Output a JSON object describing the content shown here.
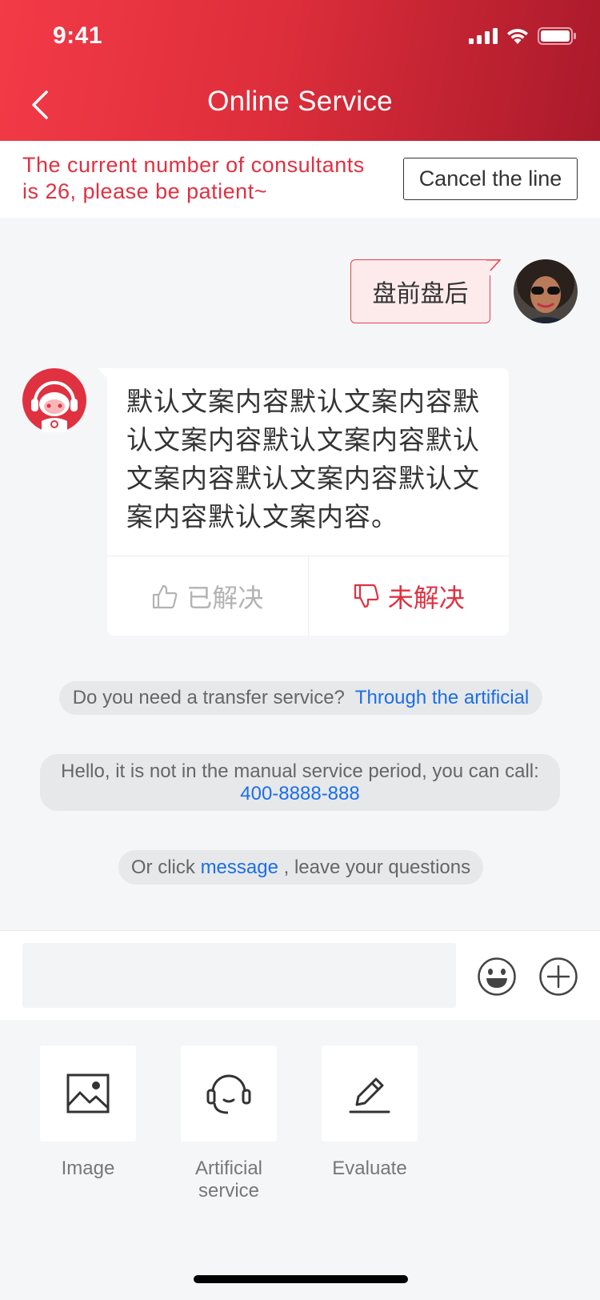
{
  "status_bar": {
    "time": "9:41"
  },
  "header": {
    "title": "Online Service"
  },
  "queue": {
    "notice": "The current number of consultants is 26, please be patient~",
    "cancel_label": "Cancel the line"
  },
  "messages": {
    "user_text": "盘前盘后",
    "bot_text": "默认文案内容默认文案内容默认文案内容默认文案内容默认文案内容默认文案内容默认文案内容默认文案内容。",
    "resolved_label": "已解决",
    "unresolved_label": "未解决"
  },
  "system": {
    "transfer_question": "Do you need a transfer service?",
    "transfer_link": "Through the artificial",
    "offhours_text": "Hello, it is not in the manual service period, you can call:",
    "phone": "400-8888-888",
    "leave_prefix": "Or click",
    "leave_link": "message",
    "leave_suffix": ", leave your questions"
  },
  "input": {
    "placeholder": ""
  },
  "tools": [
    {
      "label": "Image",
      "icon": "image-icon"
    },
    {
      "label": "Artificial service",
      "icon": "headset-icon"
    },
    {
      "label": "Evaluate",
      "icon": "pen-icon"
    }
  ],
  "colors": {
    "brand": "#e03141",
    "link": "#1a6ee8",
    "header_start": "#f33a47",
    "header_end": "#aa1a2b"
  }
}
